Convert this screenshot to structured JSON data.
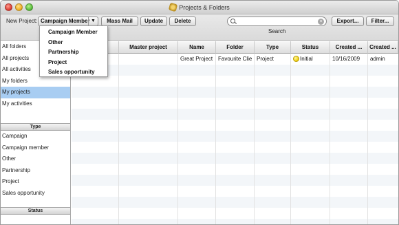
{
  "window": {
    "title": "Projects & Folders"
  },
  "toolbar": {
    "new_project_label": "New Project:",
    "new_project_value": "Campaign Member",
    "mass_mail": "Mass Mail",
    "update": "Update",
    "delete": "Delete",
    "search_label": "Search",
    "search_value": "",
    "export": "Export...",
    "filter": "Filter..."
  },
  "dropdown": {
    "options": [
      "Campaign Member",
      "Other",
      "Partnership",
      "Project",
      "Sales opportunity"
    ]
  },
  "sidebar": {
    "folders": [
      "All folders",
      "All projects",
      "All activities",
      "My folders",
      "My projects",
      "My activities"
    ],
    "selected": "My projects",
    "type_header": "Type",
    "types": [
      "Campaign",
      "Campaign member",
      "Other",
      "Partnership",
      "Project",
      "Sales opportunity"
    ],
    "status_header": "Status"
  },
  "table": {
    "columns": [
      "Master project",
      "Name",
      "Folder",
      "Type",
      "Status",
      "Created ...",
      "Created ..."
    ],
    "rows": [
      {
        "master_project": "",
        "name": "Great Project",
        "folder": "Favourite Clie",
        "type": "Project",
        "status": "Initial",
        "created_date": "10/16/2009",
        "created_by": "admin"
      }
    ]
  },
  "colors": {
    "selection": "#a8cdf2",
    "status_initial": "#f2d41c"
  },
  "icons": {
    "title": "projects-folders-icon",
    "search": "search-icon",
    "clear": "clear-search-icon",
    "dropdown": "chevron-down-icon",
    "status": "status-dot-icon"
  }
}
